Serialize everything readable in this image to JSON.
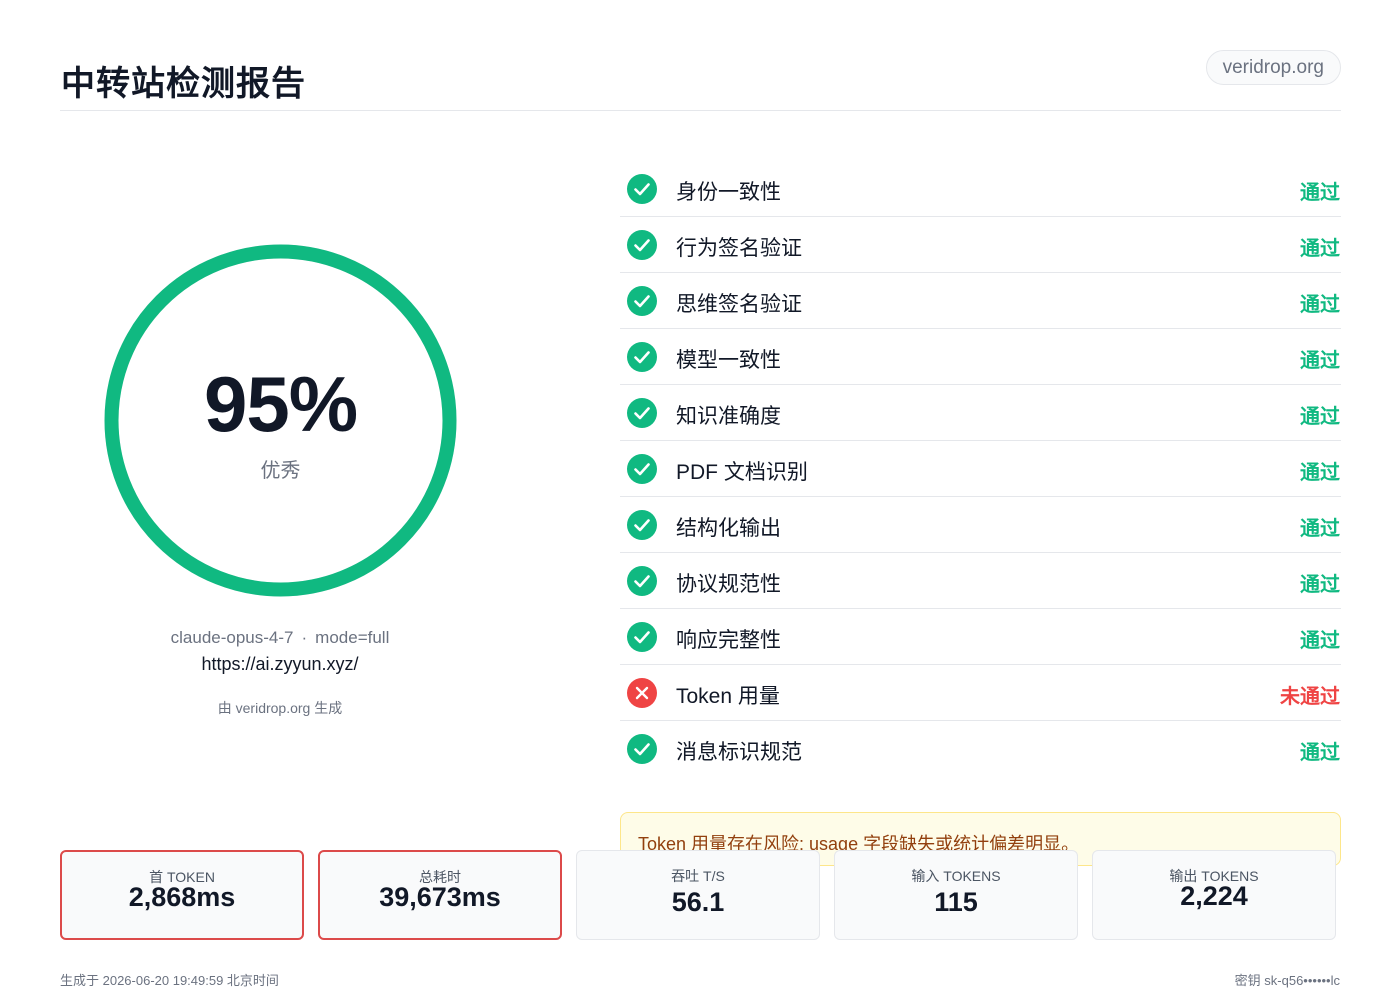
{
  "header": {
    "title": "中转站检测报告",
    "domain_badge": "veridrop.org"
  },
  "score": {
    "value": "95%",
    "percent": 95,
    "grade": "优秀",
    "ring_color": "#10b981"
  },
  "meta": {
    "model": "claude-opus-4-7",
    "separator": "·",
    "mode": "mode=full",
    "url": "https://ai.zyyun.xyz/",
    "generated_by": "由 veridrop.org 生成"
  },
  "checks": [
    {
      "label": "身份一致性",
      "status": "通过",
      "pass": true
    },
    {
      "label": "行为签名验证",
      "status": "通过",
      "pass": true
    },
    {
      "label": "思维签名验证",
      "status": "通过",
      "pass": true
    },
    {
      "label": "模型一致性",
      "status": "通过",
      "pass": true
    },
    {
      "label": "知识准确度",
      "status": "通过",
      "pass": true
    },
    {
      "label": "PDF 文档识别",
      "status": "通过",
      "pass": true
    },
    {
      "label": "结构化输出",
      "status": "通过",
      "pass": true
    },
    {
      "label": "协议规范性",
      "status": "通过",
      "pass": true
    },
    {
      "label": "响应完整性",
      "status": "通过",
      "pass": true
    },
    {
      "label": "Token 用量",
      "status": "未通过",
      "pass": false
    },
    {
      "label": "消息标识规范",
      "status": "通过",
      "pass": true
    }
  ],
  "colors": {
    "pass": "#10b981",
    "fail": "#ef4444"
  },
  "warning": "Token 用量存在风险: usage 字段缺失或统计偏差明显。",
  "stats": [
    {
      "label": "首 TOKEN",
      "value": "2,868ms",
      "alert": true
    },
    {
      "label": "总耗时",
      "value": "39,673ms",
      "alert": true
    },
    {
      "label": "吞吐 T/S",
      "value": "56.1",
      "alert": false
    },
    {
      "label": "输入 TOKENS",
      "value": "115",
      "alert": false
    },
    {
      "label": "输出 TOKENS",
      "value": "2,224",
      "alert": false
    }
  ],
  "footer": {
    "generated_at": "生成于 2026-06-20 19:49:59 北京时间",
    "key": "密钥 sk-q56••••••lc"
  }
}
